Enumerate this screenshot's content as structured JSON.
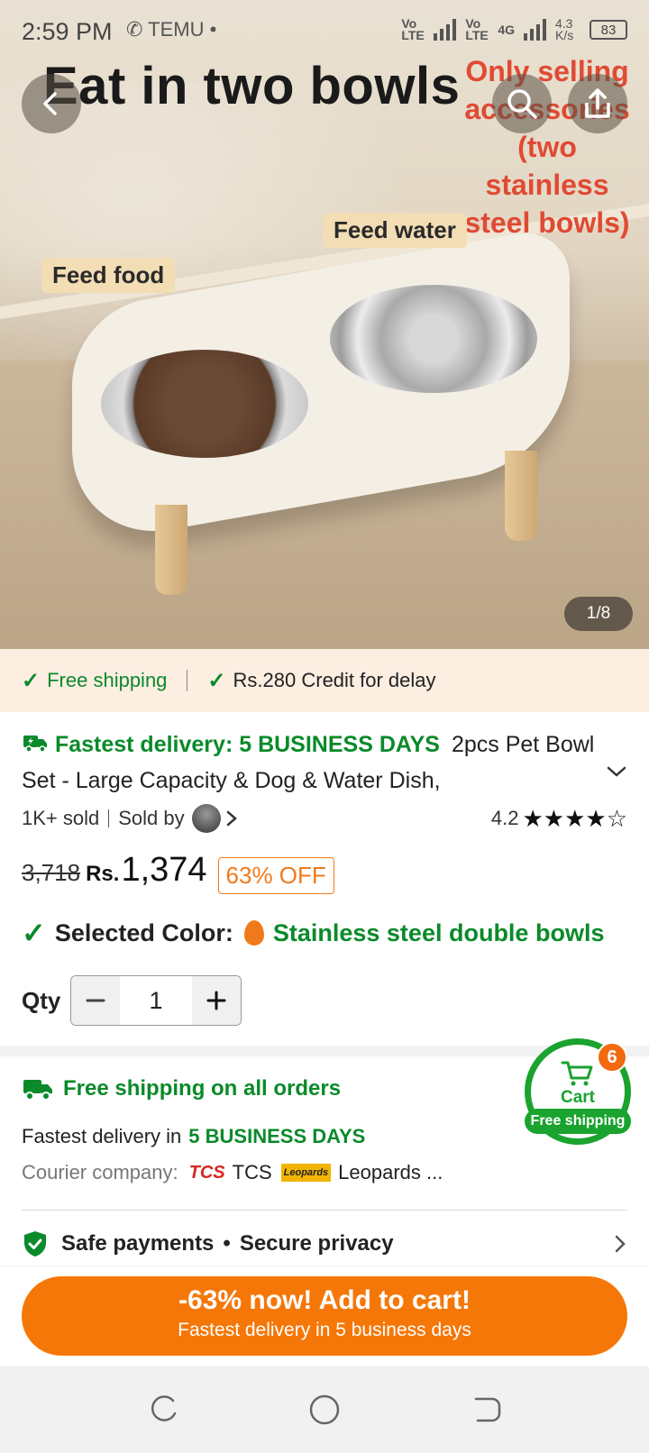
{
  "status_bar": {
    "time": "2:59 PM",
    "app_icons": "✆ TEMU •",
    "network_1": "Vo LTE",
    "network_2": "Vo LTE",
    "network_type": "4G",
    "speed": "4.3 K/s",
    "battery": "83"
  },
  "hero": {
    "title": "Eat in two bowls",
    "note": "Only selling accessories (two stainless steel bowls)",
    "tag_food": "Feed food",
    "tag_water": "Feed water",
    "image_counter": "1/8"
  },
  "shipping_strip": {
    "free_shipping": "Free shipping",
    "credit": "Rs.280 Credit for delay"
  },
  "product": {
    "fastest_delivery": "Fastest delivery: 5 BUSINESS DAYS",
    "title": "2pcs Pet Bowl Set - Large Capacity & Dog & Water Dish,",
    "sold": "1K+ sold",
    "sold_by": "Sold by",
    "rating": "4.2",
    "rating_value": 4.2,
    "original_price": "3,718",
    "currency": "Rs.",
    "price": "1,374",
    "discount": "63% OFF",
    "selected_color_label": "Selected Color:",
    "selected_color_value": "Stainless steel double bowls",
    "qty_label": "Qty",
    "qty_value": "1"
  },
  "delivery": {
    "free_all": "Free shipping on all orders",
    "fastest_label": "Fastest delivery in",
    "fastest_value": "5 BUSINESS DAYS",
    "courier_label": "Courier company:",
    "courier_1_logo": "TCS",
    "courier_1": "TCS",
    "courier_2_logo": "Leopards",
    "courier_2": "Leopards ..."
  },
  "safety": {
    "safe_payments": "Safe payments",
    "secure_privacy": "Secure privacy"
  },
  "cart": {
    "label": "Cart",
    "count": "6",
    "free_shipping": "Free shipping"
  },
  "cta": {
    "main": "-63% now! Add to cart!",
    "sub": "Fastest delivery in 5 business days"
  },
  "colors": {
    "accent_orange": "#f57707",
    "green": "#0a8a2a"
  }
}
